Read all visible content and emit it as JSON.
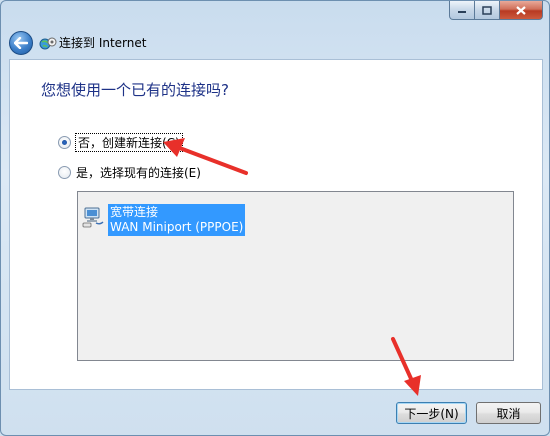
{
  "window": {
    "title": "连接到 Internet"
  },
  "content": {
    "heading": "您想使用一个已有的连接吗?",
    "options": [
      {
        "label": "否，创建新连接(C)",
        "selected": true
      },
      {
        "label": "是，选择现有的连接(E)",
        "selected": false
      }
    ],
    "connections": [
      {
        "name": "宽带连接",
        "device": "WAN Miniport (PPPOE)"
      }
    ]
  },
  "buttons": {
    "next": "下一步(N)",
    "cancel": "取消"
  },
  "colors": {
    "annotation_arrow": "#e8302a",
    "heading": "#1e3287",
    "selection": "#3399ff"
  }
}
